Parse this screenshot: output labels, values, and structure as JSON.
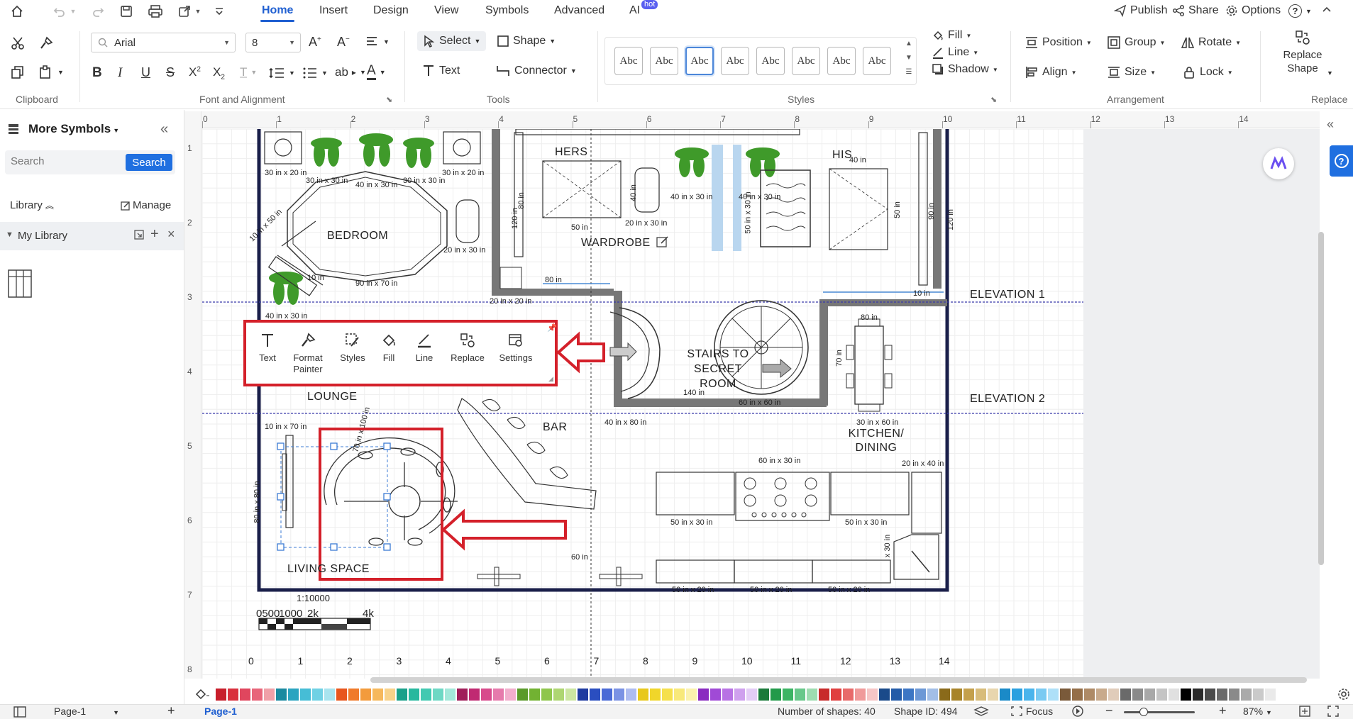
{
  "menu": {
    "tabs": [
      {
        "label": "Home",
        "active": true
      },
      {
        "label": "Insert"
      },
      {
        "label": "Design"
      },
      {
        "label": "View"
      },
      {
        "label": "Symbols"
      },
      {
        "label": "Advanced"
      },
      {
        "label": "AI"
      }
    ],
    "hot_badge": "hot",
    "publish": "Publish",
    "share": "Share",
    "options": "Options",
    "help": "?"
  },
  "ribbon": {
    "font_name": "Arial",
    "font_size": "8",
    "select": "Select",
    "shape": "Shape",
    "text": "Text",
    "connector": "Connector",
    "style_samples": [
      "Abc",
      "Abc",
      "Abc",
      "Abc",
      "Abc",
      "Abc",
      "Abc",
      "Abc"
    ],
    "fill": "Fill",
    "line": "Line",
    "shadow": "Shadow",
    "position": "Position",
    "group": "Group",
    "rotate": "Rotate",
    "align": "Align",
    "size": "Size",
    "lock": "Lock",
    "replace_shape_1": "Replace",
    "replace_shape_2": "Shape",
    "groups": {
      "clipboard": "Clipboard",
      "font": "Font and Alignment",
      "tools": "Tools",
      "styles": "Styles",
      "arrangement": "Arrangement",
      "replace": "Replace"
    }
  },
  "sidebar": {
    "title": "More Symbols",
    "search_placeholder": "Search",
    "search_button": "Search",
    "library": "Library",
    "manage": "Manage",
    "my_library": "My Library"
  },
  "ruler": {
    "top": [
      "0",
      "1",
      "2",
      "3",
      "4",
      "5",
      "6",
      "7",
      "8",
      "9",
      "10",
      "11",
      "12",
      "13",
      "14"
    ],
    "left": [
      "1",
      "2",
      "3",
      "4",
      "5",
      "6",
      "7",
      "8"
    ]
  },
  "floor_plan": {
    "labels": {
      "bedroom": "BEDROOM",
      "hers": "HERS",
      "his": "HIS",
      "wardrobe": "WARDROBE",
      "lounge": "LOUNGE",
      "stairs_1": "STAIRS TO",
      "stairs_2": "SECRET",
      "stairs_3": "ROOM",
      "bar": "BAR",
      "kitchen_1": "KITCHEN/",
      "kitchen_2": "DINING",
      "living": "LIVING SPACE",
      "elevation1": "ELEVATION 1",
      "elevation2": "ELEVATION 2",
      "scale": "1:10000",
      "scale_ticks": "0500",
      "scale_1000": "1000",
      "scale_2k": "2k",
      "scale_4k": "4k"
    },
    "dims": {
      "d1": "30 in x 20 in",
      "d2": "30 in x 30 in",
      "d3": "40 in x 30 in",
      "d4": "30 in x 30 in",
      "d5": "30 in x 20 in",
      "d6": "10 in x 50 in",
      "d7": "20 in x 30 in",
      "d8": "10 in",
      "d9": "90 in x 70 in",
      "d10": "40 in x 30 in",
      "d11": "120 in",
      "d12": "80 in",
      "d13": "50 in",
      "d14": "40 in",
      "d15": "20 in x 30 in",
      "d16": "40 in x 30 in",
      "d17": "40 in x 30 in",
      "d18": "50 in x 30 in",
      "d19": "40 in",
      "d20": "50 in",
      "d21": "90 in",
      "d22": "120 in",
      "d23": "80 in",
      "d24": "10 in",
      "d25": "20 in x 20 in",
      "d26": "80 in",
      "d27": "70 in",
      "d28": "140 in",
      "d29": "60 in x 60 in",
      "d30": "30 in x 60 in",
      "d31": "40 in x 80 in",
      "d32": "10 in x 70 in",
      "d33": "70 in x 100 in",
      "d34": "80 in x 80 in",
      "d35": "60 in x 30 in",
      "d36": "50 in x 30 in",
      "d37": "50 in x 30 in",
      "d38": "20 in x 40 in",
      "d39": "x 30 in",
      "d40": "60 in",
      "d41": "50 in x 20 in",
      "d42": "50 in x 20 in",
      "d43": "50 in x 20 in"
    },
    "bottom_ruler": [
      "0",
      "1",
      "2",
      "3",
      "4",
      "5",
      "6",
      "7",
      "8",
      "9",
      "10",
      "11",
      "12",
      "13",
      "14"
    ]
  },
  "floating_toolbar": {
    "items": [
      "Text",
      "Format Painter",
      "Styles",
      "Fill",
      "Line",
      "Replace",
      "Settings"
    ]
  },
  "status": {
    "page_selector": "Page-1",
    "page_tab": "Page-1",
    "shapes": "Number of shapes: 40",
    "shape_id": "Shape ID: 494",
    "focus": "Focus",
    "zoom": "87%"
  },
  "palette": [
    "#c81e2b",
    "#d9303d",
    "#e0465e",
    "#e8657a",
    "#f0a0a8",
    "#1a8aa0",
    "#2aa4c0",
    "#46bdd6",
    "#6fd1e4",
    "#a8e4ef",
    "#e8561c",
    "#f07a2a",
    "#f39b3c",
    "#f6b85c",
    "#f8d28a",
    "#1aa08a",
    "#27b89e",
    "#42c9b1",
    "#6dd8c4",
    "#a3e8da",
    "#a01e5a",
    "#c02a72",
    "#d84a8c",
    "#e67aac",
    "#f2aecd",
    "#5a9a2a",
    "#72b232",
    "#8fc64c",
    "#aed672",
    "#cce6a2",
    "#1e3aa0",
    "#2a4ec0",
    "#4a6ad6",
    "#7a92e4",
    "#aebcf0",
    "#e8c81a",
    "#f0d62a",
    "#f5e04c",
    "#f8e97a",
    "#fbf2ae",
    "#8a2ac0",
    "#a04ad6",
    "#b872e4",
    "#cfa0ee",
    "#e4cdf6",
    "#1a7a3a",
    "#229a4a",
    "#3cb464",
    "#68c88a",
    "#9edcb0",
    "#c82a2a",
    "#e04040",
    "#e86a6a",
    "#f09a9a",
    "#f6c6c6",
    "#1a4a8a",
    "#245ca8",
    "#3c76c4",
    "#6c98d6",
    "#a2bee6",
    "#8a6a1a",
    "#a8842a",
    "#c4a04c",
    "#d8bc7a",
    "#e8d6ae",
    "#1a8ac8",
    "#2aa0e0",
    "#4ab4ec",
    "#7acaf2",
    "#aee0f8",
    "#7a5a3a",
    "#946e48",
    "#ae8a66",
    "#c8aa8c",
    "#e0ccba",
    "#6a6a6a",
    "#8a8a8a",
    "#a8a8a8",
    "#c4c4c4",
    "#e0e0e0",
    "#000000",
    "#2a2a2a",
    "#4a4a4a",
    "#6a6a6a",
    "#8a8a8a",
    "#aaaaaa",
    "#cacaca",
    "#eaeaea"
  ]
}
